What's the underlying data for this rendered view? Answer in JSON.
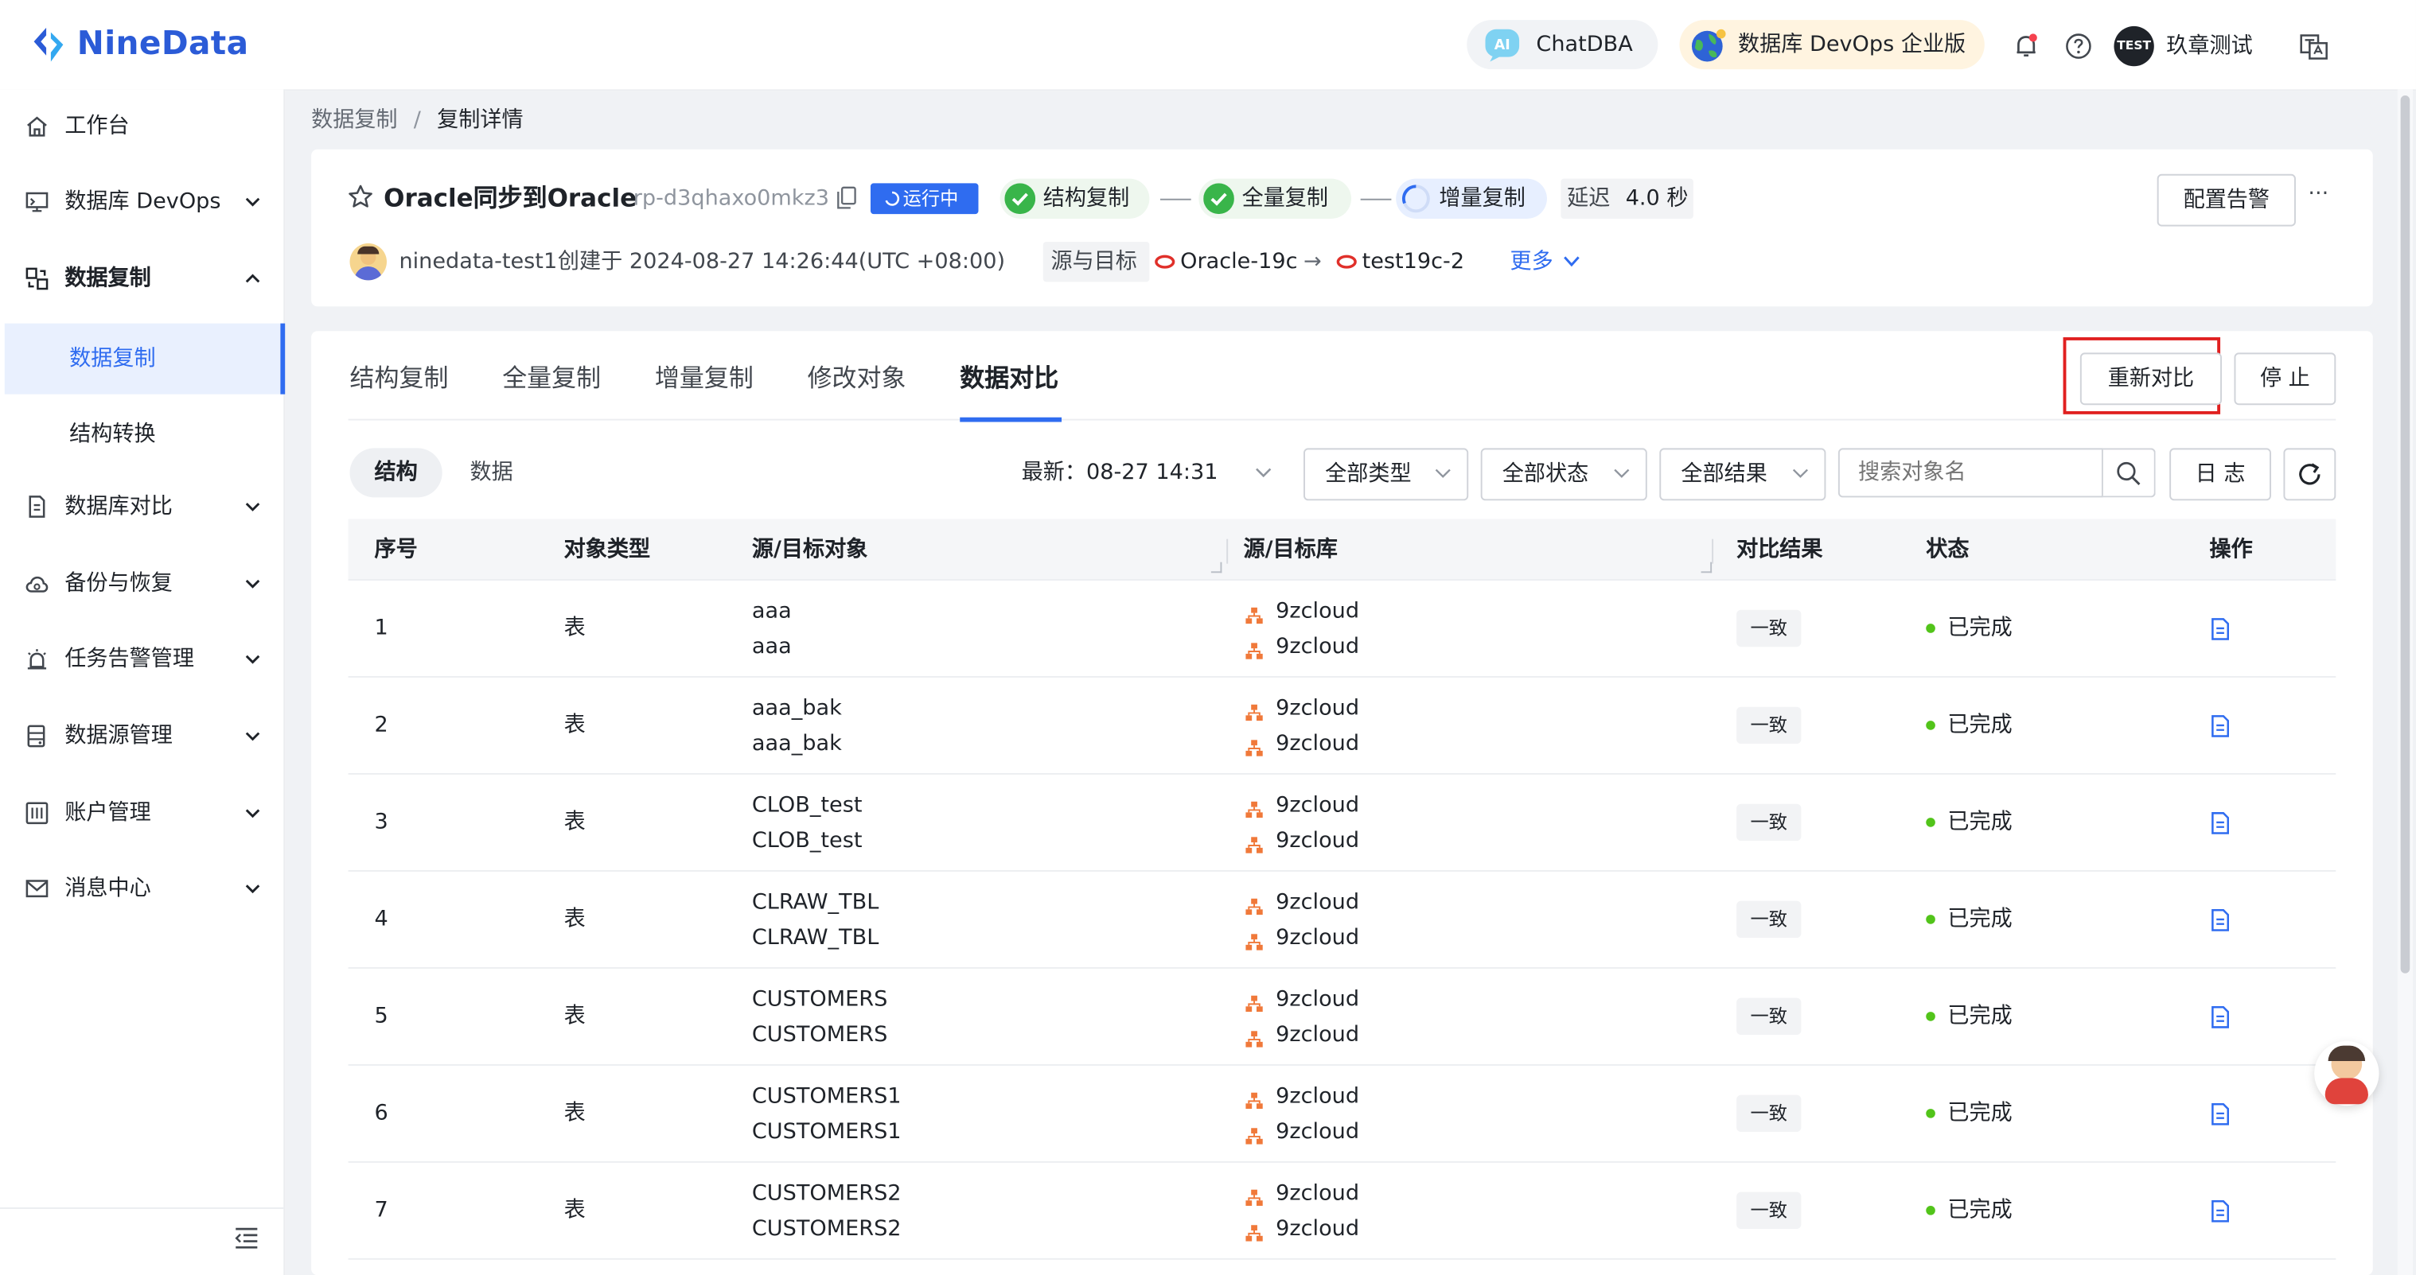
{
  "brand": {
    "name": "NineData"
  },
  "header": {
    "chatdba_label": "ChatDBA",
    "edition_label": "数据库 DevOps 企业版",
    "avatar_text": "TEST",
    "user_name": "玖章测试"
  },
  "sidebar": {
    "items": [
      {
        "label": "工作台"
      },
      {
        "label": "数据库 DevOps"
      },
      {
        "label": "数据复制"
      },
      {
        "label": "数据复制"
      },
      {
        "label": "结构转换"
      },
      {
        "label": "数据库对比"
      },
      {
        "label": "备份与恢复"
      },
      {
        "label": "任务告警管理"
      },
      {
        "label": "数据源管理"
      },
      {
        "label": "账户管理"
      },
      {
        "label": "消息中心"
      }
    ]
  },
  "breadcrumb": {
    "parent": "数据复制",
    "separator": "/",
    "current": "复制详情"
  },
  "task": {
    "name": "Oracle同步到Oracle",
    "id": "rp-d3qhaxo0mkz3",
    "status": "运行中",
    "phases": [
      "结构复制",
      "全量复制",
      "增量复制"
    ],
    "delay_label": "延迟",
    "delay_value": "4.0 秒",
    "owner": "ninedata-test1",
    "created": "创建于 2024-08-27 14:26:44(UTC +08:00)",
    "src_tgt_label": "源与目标",
    "source": "Oracle-19c",
    "arrow": "→",
    "target": "test19c-2",
    "more_label": "更多",
    "alert_button": "配置告警",
    "more_menu": "···"
  },
  "tabs": [
    "结构复制",
    "全量复制",
    "增量复制",
    "修改对象",
    "数据对比"
  ],
  "actions": {
    "recompare": "重新对比",
    "stop": "停 止"
  },
  "compare": {
    "sub_tabs": [
      "结构",
      "数据"
    ],
    "latest_label": "最新：",
    "latest_time": "08-27 14:31",
    "filters": [
      "全部类型",
      "全部状态",
      "全部结果"
    ],
    "search_placeholder": "搜索对象名",
    "log_button": "日 志"
  },
  "table": {
    "columns": [
      "序号",
      "对象类型",
      "源/目标对象",
      "源/目标库",
      "对比结果",
      "状态",
      "操作"
    ],
    "rows": [
      {
        "no": "1",
        "type": "表",
        "src_obj": "aaa",
        "tgt_obj": "aaa",
        "src_db": "9zcloud",
        "tgt_db": "9zcloud",
        "result": "一致",
        "status": "已完成"
      },
      {
        "no": "2",
        "type": "表",
        "src_obj": "aaa_bak",
        "tgt_obj": "aaa_bak",
        "src_db": "9zcloud",
        "tgt_db": "9zcloud",
        "result": "一致",
        "status": "已完成"
      },
      {
        "no": "3",
        "type": "表",
        "src_obj": "CLOB_test",
        "tgt_obj": "CLOB_test",
        "src_db": "9zcloud",
        "tgt_db": "9zcloud",
        "result": "一致",
        "status": "已完成"
      },
      {
        "no": "4",
        "type": "表",
        "src_obj": "CLRAW_TBL",
        "tgt_obj": "CLRAW_TBL",
        "src_db": "9zcloud",
        "tgt_db": "9zcloud",
        "result": "一致",
        "status": "已完成"
      },
      {
        "no": "5",
        "type": "表",
        "src_obj": "CUSTOMERS",
        "tgt_obj": "CUSTOMERS",
        "src_db": "9zcloud",
        "tgt_db": "9zcloud",
        "result": "一致",
        "status": "已完成"
      },
      {
        "no": "6",
        "type": "表",
        "src_obj": "CUSTOMERS1",
        "tgt_obj": "CUSTOMERS1",
        "src_db": "9zcloud",
        "tgt_db": "9zcloud",
        "result": "一致",
        "status": "已完成"
      },
      {
        "no": "7",
        "type": "表",
        "src_obj": "CUSTOMERS2",
        "tgt_obj": "CUSTOMERS2",
        "src_db": "9zcloud",
        "tgt_db": "9zcloud",
        "result": "一致",
        "status": "已完成"
      }
    ]
  },
  "colors": {
    "brand": "#2b5bd7",
    "accent": "#2f6cf0",
    "success": "#39b54a",
    "status_blue": "#2f6cf0",
    "highlight_red": "#e02020",
    "db_icon": "#f0793a"
  }
}
